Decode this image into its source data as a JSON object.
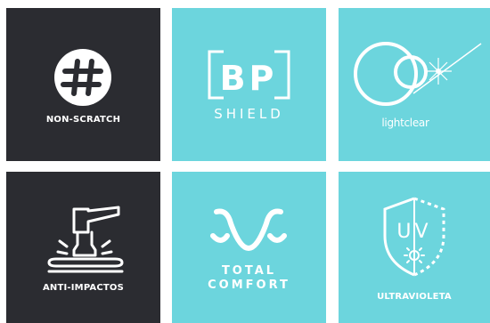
{
  "tiles": [
    {
      "label": "NON-SCRATCH",
      "icon": "hashtag-circle-icon",
      "background": "#2b2c31"
    },
    {
      "logo_letters": "BP",
      "word": "SHIELD",
      "icon": "bp-shield-logo-icon",
      "background": "#6cd5dd"
    },
    {
      "word": "lightclear",
      "icon": "lightclear-crescent-icon",
      "background": "#6cd5dd"
    },
    {
      "label": "ANTI-IMPACTOS",
      "icon": "hammer-impact-icon",
      "background": "#2b2c31"
    },
    {
      "line1": "TOTAL",
      "line2": "COMFORT",
      "icon": "flexible-arc-icon",
      "background": "#6cd5dd"
    },
    {
      "label": "ULTRAVIOLETA",
      "logo_letters": "UV",
      "icon": "uv-shield-icon",
      "background": "#6cd5dd"
    }
  ]
}
